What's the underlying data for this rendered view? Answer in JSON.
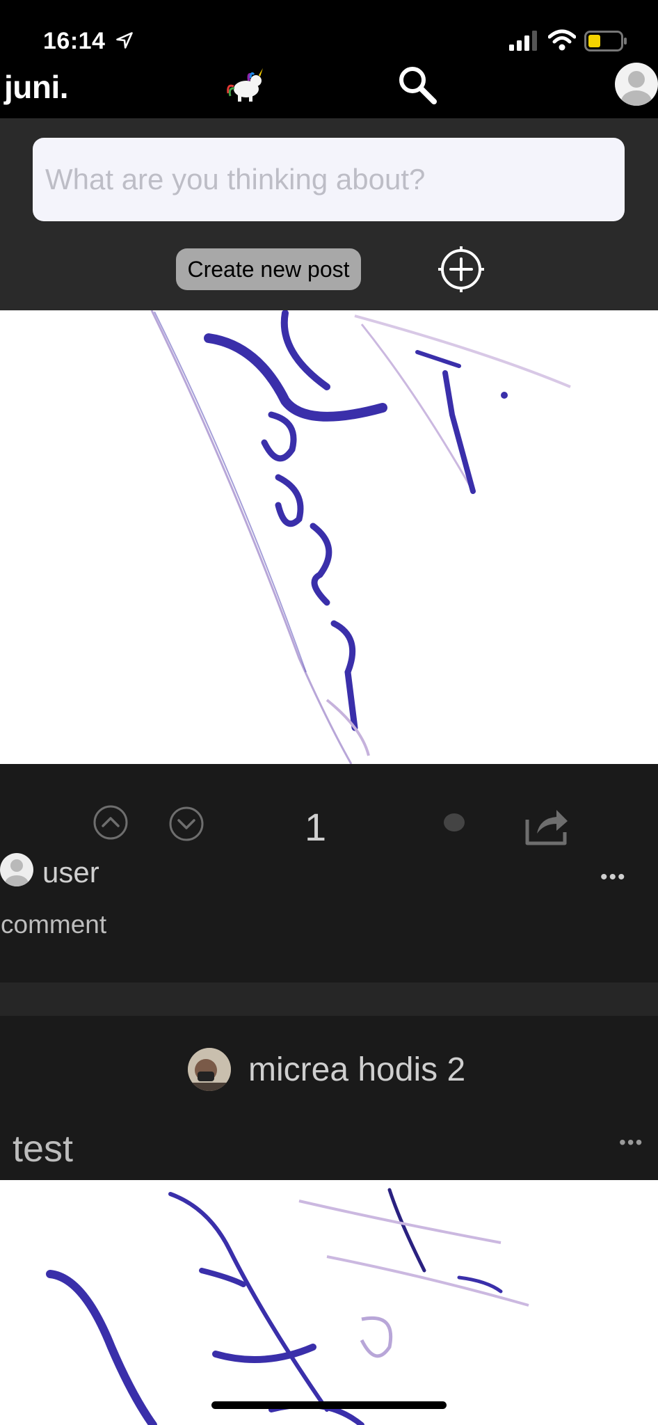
{
  "status_bar": {
    "time": "16:14"
  },
  "header": {
    "logo": "juni."
  },
  "composer": {
    "placeholder": "What are you thinking about?",
    "create_label": "Create new post"
  },
  "post1": {
    "score": "1",
    "comment": {
      "user": "user",
      "text": "comment",
      "menu": "•••"
    }
  },
  "post2": {
    "author": "micrea hodis 2",
    "title": "test",
    "menu": "•••"
  },
  "colors": {
    "background": "#000000",
    "composer_bg": "#2a2a2a",
    "footer_bg": "#1a1a1a",
    "ink": "#3b2fb0"
  },
  "icons": [
    "location-arrow-icon",
    "signal-icon",
    "wifi-icon",
    "battery-icon",
    "unicorn-logo-icon",
    "search-icon",
    "avatar-icon",
    "add-media-icon",
    "upvote-icon",
    "downvote-icon",
    "comment-icon",
    "share-icon"
  ]
}
